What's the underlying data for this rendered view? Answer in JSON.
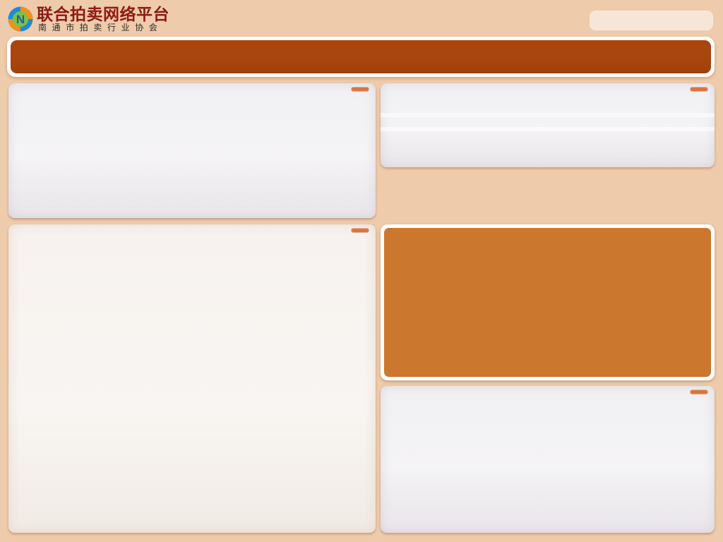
{
  "header": {
    "logo": {
      "icon": "n-logo-icon",
      "mark_letter": "N",
      "title": "联合拍卖网络平台",
      "subtitle": "南通市拍卖行业协会"
    },
    "search": {
      "placeholder": ""
    }
  },
  "colors": {
    "page_background": "#eecbab",
    "nav_bar": "#a9450d",
    "feature_box": "#cb772d",
    "panel_handle": "#e0733a",
    "logo_title": "#8c1b12",
    "logo_blue": "#1e8ad6",
    "logo_orange": "#f0901e",
    "logo_green": "#7cc242"
  },
  "panels": {
    "top_left": {
      "handle_icon": "panel-handle-icon"
    },
    "top_right": {
      "handle_icon": "panel-handle-icon"
    },
    "bottom_left": {
      "handle_icon": "panel-handle-icon"
    },
    "bottom_right": {
      "handle_icon": "panel-handle-icon"
    }
  }
}
